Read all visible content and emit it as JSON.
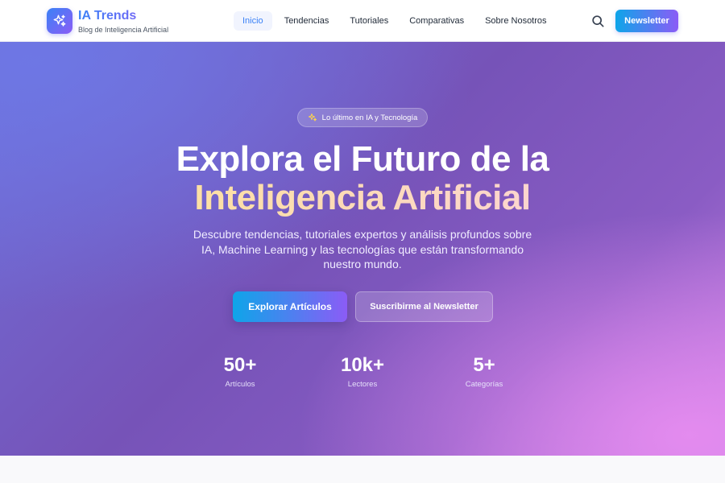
{
  "brand": {
    "title": "IA Trends",
    "subtitle": "Blog de Inteligencia Artificial",
    "logo_icon": "sparkles-icon"
  },
  "nav": {
    "items": [
      {
        "label": "Inicio",
        "active": true
      },
      {
        "label": "Tendencias",
        "active": false
      },
      {
        "label": "Tutoriales",
        "active": false
      },
      {
        "label": "Comparativas",
        "active": false
      },
      {
        "label": "Sobre Nosotros",
        "active": false
      }
    ],
    "search_icon": "search-icon",
    "newsletter_label": "Newsletter"
  },
  "hero": {
    "badge_icon": "sparkles-icon",
    "badge_text": "Lo último en IA y Tecnología",
    "title_line1": "Explora el Futuro de la",
    "title_line2": "Inteligencia Artificial",
    "description": "Descubre tendencias, tutoriales expertos y análisis profundos sobre IA, Machine Learning y las tecnologías que están transformando nuestro mundo.",
    "primary_cta": "Explorar Artículos",
    "secondary_cta": "Suscribirme al Newsletter",
    "stats": [
      {
        "value": "50+",
        "label": "Artículos"
      },
      {
        "value": "10k+",
        "label": "Lectores"
      },
      {
        "value": "5+",
        "label": "Categorías"
      }
    ]
  },
  "colors": {
    "accent_blue": "#3b82f6",
    "accent_purple": "#8b5cf6",
    "hero_gradient_start": "#6f6fd8",
    "hero_gradient_end": "#c27ee0",
    "title_highlight": "#fde68a"
  }
}
